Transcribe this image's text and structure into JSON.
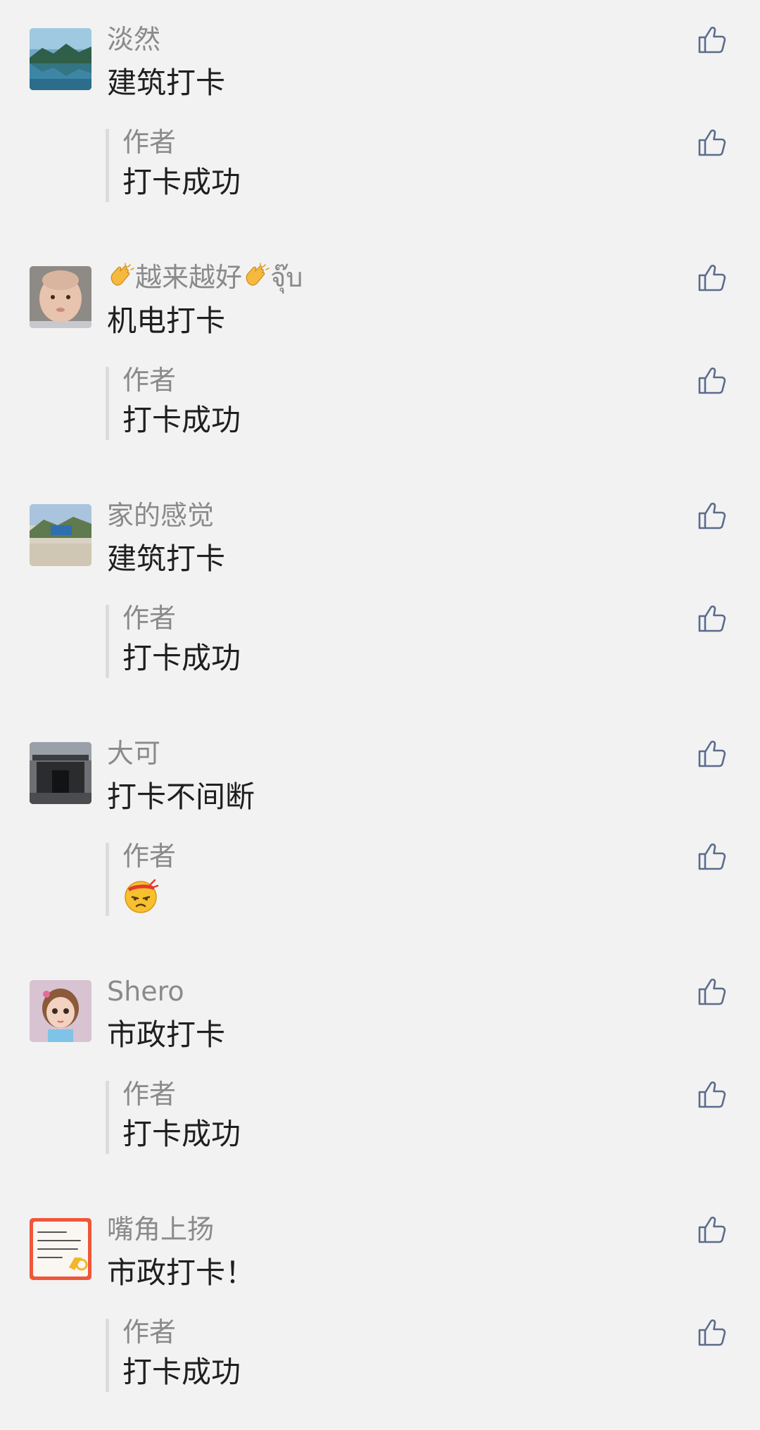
{
  "comments": [
    {
      "name": "淡然",
      "text": "建筑打卡",
      "reply": {
        "author": "作者",
        "text": "打卡成功"
      }
    },
    {
      "name_parts": [
        "越来越好",
        "จุ๊บ"
      ],
      "text": "机电打卡",
      "reply": {
        "author": "作者",
        "text": "打卡成功"
      }
    },
    {
      "name": "家的感觉",
      "text": "建筑打卡",
      "reply": {
        "author": "作者",
        "text": "打卡成功"
      }
    },
    {
      "name": "大可",
      "text": "打卡不间断",
      "reply": {
        "author": "作者",
        "emoji": "annoyed-face-emoji"
      }
    },
    {
      "name": "Shero",
      "text": "市政打卡",
      "reply": {
        "author": "作者",
        "text": "打卡成功"
      }
    },
    {
      "name": "嘴角上扬",
      "text": "市政打卡！",
      "reply": {
        "author": "作者",
        "text": "打卡成功"
      }
    }
  ],
  "icons": {
    "like": "thumbs-up-icon",
    "clap": "clapping-hands-emoji"
  },
  "colors": {
    "background": "#f2f2f2",
    "name": "#8a8a8a",
    "text": "#1f1f1f",
    "like_icon": "#5b6b8c",
    "reply_bar": "#dcdcdc"
  }
}
